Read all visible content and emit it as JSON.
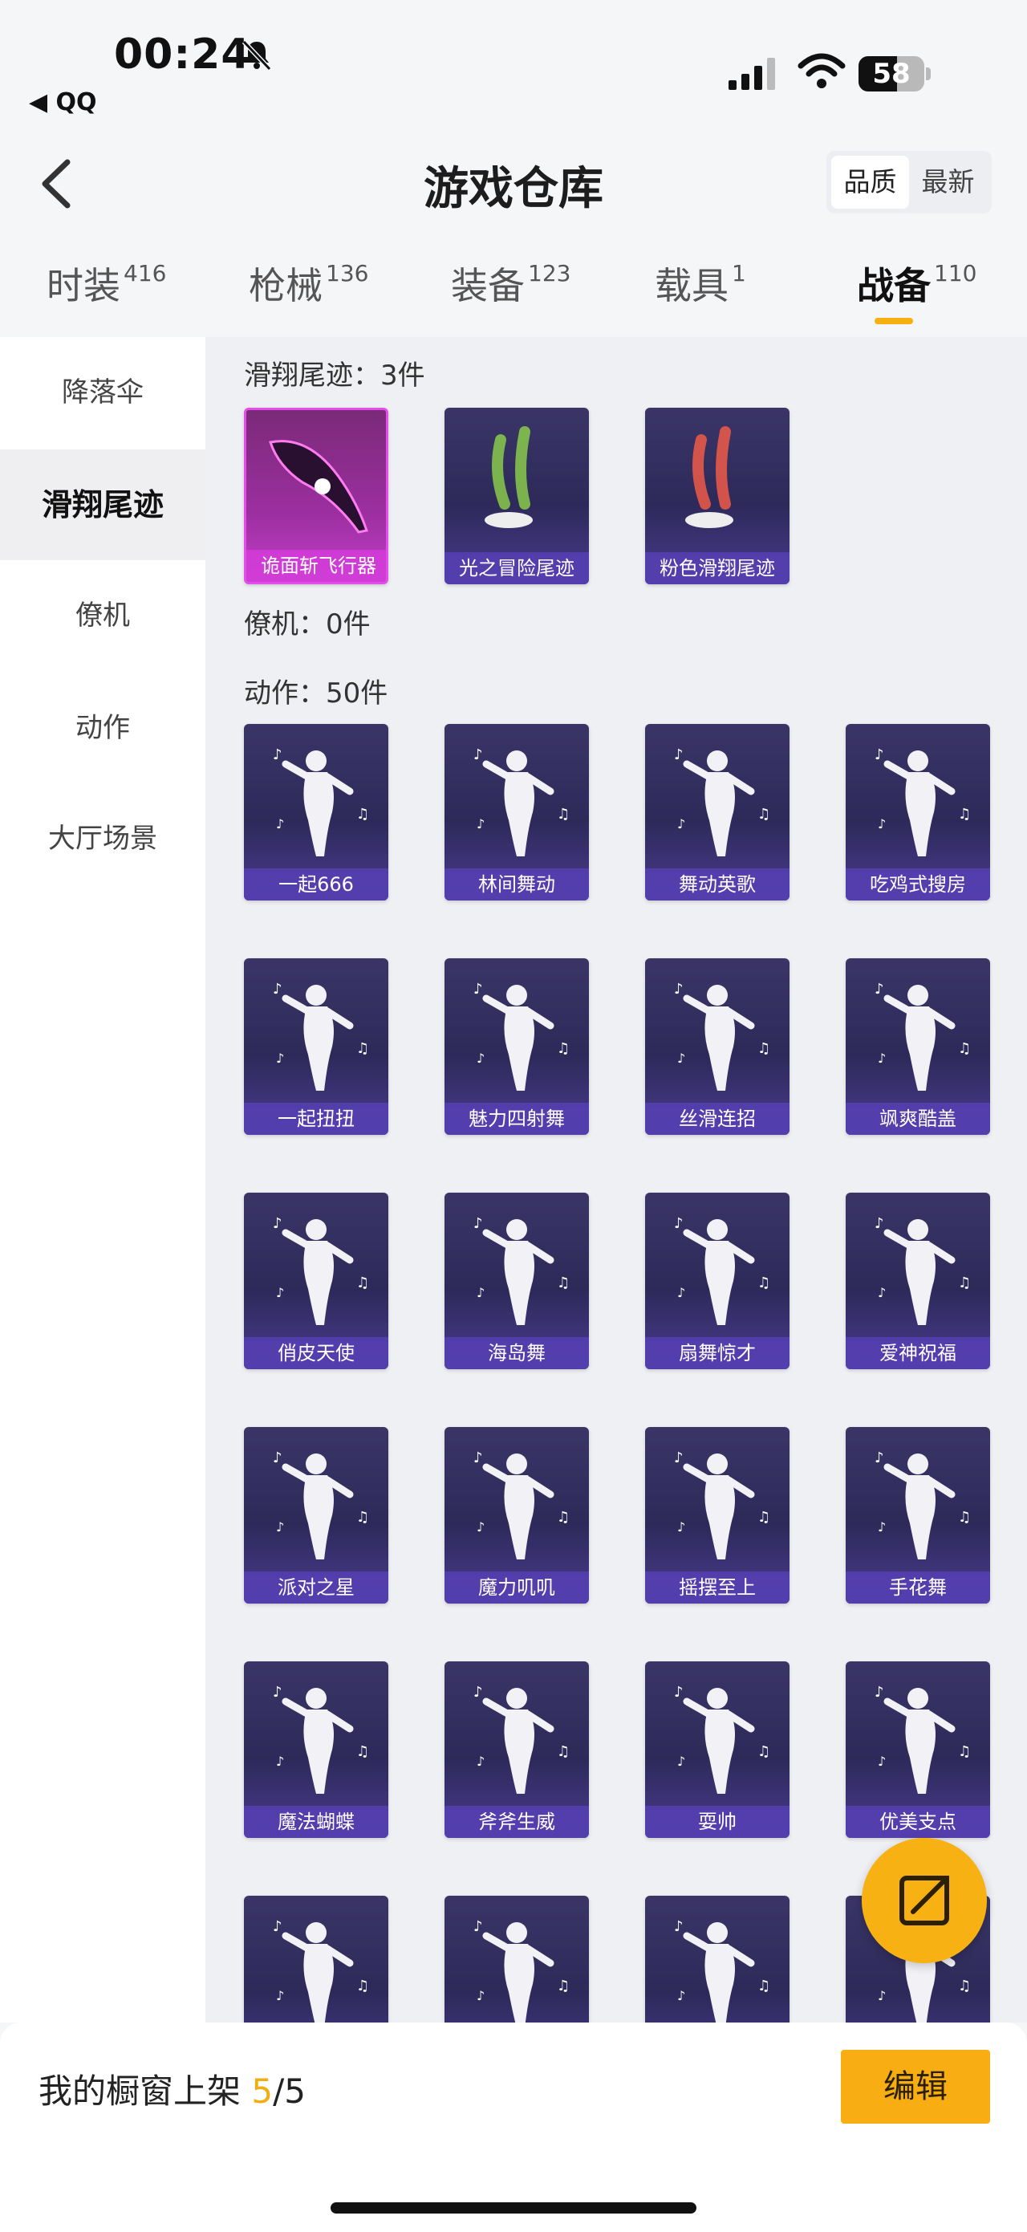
{
  "status_bar": {
    "time": "00:24",
    "back_app": "◀ QQ",
    "battery_pct": "58",
    "battery_level": 0.58
  },
  "header": {
    "title": "游戏仓库",
    "sort_options": [
      "品质",
      "最新"
    ],
    "sort_active": "品质"
  },
  "top_tabs": [
    {
      "label": "时装",
      "count": "416"
    },
    {
      "label": "枪械",
      "count": "136"
    },
    {
      "label": "装备",
      "count": "123"
    },
    {
      "label": "载具",
      "count": "1"
    },
    {
      "label": "战备",
      "count": "110"
    }
  ],
  "side_nav": [
    "降落伞",
    "滑翔尾迹",
    "僚机",
    "动作",
    "大厅场景"
  ],
  "sections": {
    "glide": {
      "title": "滑翔尾迹：3件",
      "items": [
        "诡面斩飞行器",
        "光之冒险尾迹",
        "粉色滑翔尾迹"
      ]
    },
    "wingman": {
      "title": "僚机：0件"
    },
    "emotes": {
      "title": "动作：50件",
      "items": [
        "一起666",
        "林间舞动",
        "舞动英歌",
        "吃鸡式搜房",
        "一起扭扭",
        "魅力四射舞",
        "丝滑连招",
        "飒爽酷盖",
        "俏皮天使",
        "海岛舞",
        "扇舞惊才",
        "爱神祝福",
        "派对之星",
        "魔力叽叽",
        "摇摆至上",
        "手花舞",
        "魔法蝴蝶",
        "斧斧生威",
        "耍帅",
        "优美支点"
      ]
    }
  },
  "bottom": {
    "showcase_label": "我的橱窗上架",
    "showcase_current": "5",
    "showcase_total": "/5",
    "edit_label": "编辑"
  },
  "colors": {
    "accent": "#f7b112",
    "card_bg": "#2d2a5a",
    "card_label": "#5640b4"
  }
}
